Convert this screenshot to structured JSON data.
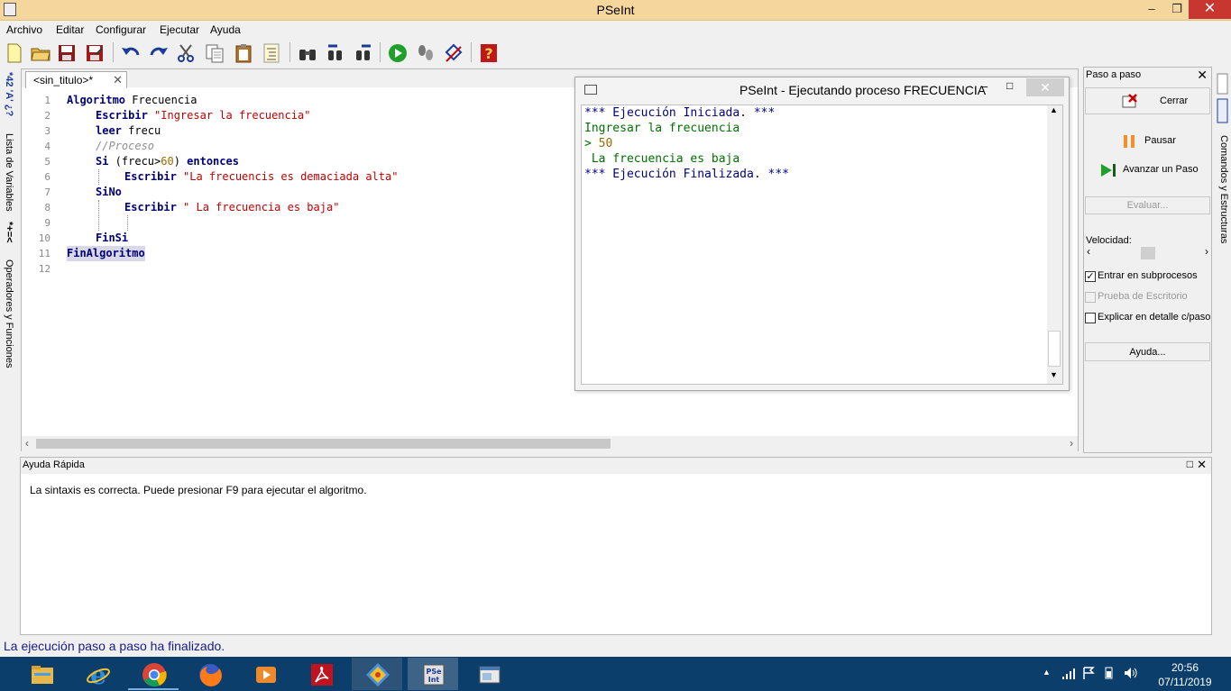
{
  "window": {
    "title": "PSeInt"
  },
  "menu": [
    "Archivo",
    "Editar",
    "Configurar",
    "Ejecutar",
    "Ayuda"
  ],
  "left_tabs": {
    "variables": "Lista de Variables",
    "operators": "Operadores y Funciones",
    "variables_symbols": "*42 'A' ¿?",
    "operators_symbols": "*+=<"
  },
  "editor": {
    "tab_label": "<sin_titulo>*",
    "line_numbers": [
      "1",
      "2",
      "3",
      "4",
      "5",
      "6",
      "7",
      "8",
      "9",
      "10",
      "11",
      "12"
    ],
    "code": {
      "l1_kw": "Algoritmo",
      "l1_name": " Frecuencia",
      "l2_kw": "Escribir",
      "l2_str": "\"Ingresar la frecuencia\"",
      "l3_kw": "leer",
      "l3_var": " frecu",
      "l4_comment": "//Proceso",
      "l5_kw": "Si",
      "l5_open": " (frecu>",
      "l5_num": "60",
      "l5_close": ") ",
      "l5_kw2": "entonces",
      "l6_kw": "Escribir",
      "l6_str": "\"La frecuencis es demaciada alta\"",
      "l7_kw": "SiNo",
      "l8_kw": "Escribir",
      "l8_str": "\" La frecuencia es baja\"",
      "l10_kw": "FinSi",
      "l11_kw": "FinAlgoritmo"
    }
  },
  "exec_window": {
    "title": "PSeInt - Ejecutando proceso FRECUENCIA",
    "lines": [
      {
        "text": "*** Ejecución Iniciada. ***",
        "color": "#000080"
      },
      {
        "text": "Ingresar la frecuencia",
        "color": "#007000"
      },
      {
        "prompt": "> ",
        "value": "50",
        "color": "#007000",
        "value_color": "#9a6a00"
      },
      {
        "text": " La frecuencia es baja",
        "color": "#007000"
      },
      {
        "text": "*** Ejecución Finalizada. ***",
        "color": "#000080"
      }
    ]
  },
  "step_panel": {
    "title": "Paso a paso",
    "close_btn": "Cerrar",
    "pause_btn": "Pausar",
    "step_btn": "Avanzar un Paso",
    "eval_btn": "Evaluar...",
    "speed_label": "Velocidad:",
    "speed_value": 0.5,
    "chk_subprocesos": {
      "label": "Entrar en subprocesos",
      "checked": true
    },
    "chk_escritorio": {
      "label": "Prueba de Escritorio",
      "checked": false,
      "disabled": true
    },
    "chk_explicar": {
      "label": "Explicar en detalle c/paso",
      "checked": false
    },
    "help_btn": "Ayuda..."
  },
  "right_tab": {
    "label": "Comandos y Estructuras"
  },
  "quick_help": {
    "title": "Ayuda Rápida",
    "text": "La sintaxis es correcta. Puede presionar F9 para ejecutar el algoritmo."
  },
  "status": "La ejecución paso a paso ha finalizado.",
  "taskbar": {
    "apps": [
      {
        "name": "file-explorer-icon",
        "color": "#e8b84a"
      },
      {
        "name": "internet-explorer-icon",
        "color": "#2d8fd8"
      },
      {
        "name": "chrome-icon",
        "color": "#db4437"
      },
      {
        "name": "firefox-icon",
        "color": "#ff7a1a"
      },
      {
        "name": "media-player-icon",
        "color": "#ef8a2c"
      },
      {
        "name": "acrobat-icon",
        "color": "#c1121f"
      },
      {
        "name": "git-icon",
        "color": "#4a90d9"
      },
      {
        "name": "pseint-icon",
        "color": "#e0e0e0"
      },
      {
        "name": "window-app-icon",
        "color": "#e8e8e8"
      }
    ],
    "time": "20:56",
    "date": "07/11/2019"
  }
}
